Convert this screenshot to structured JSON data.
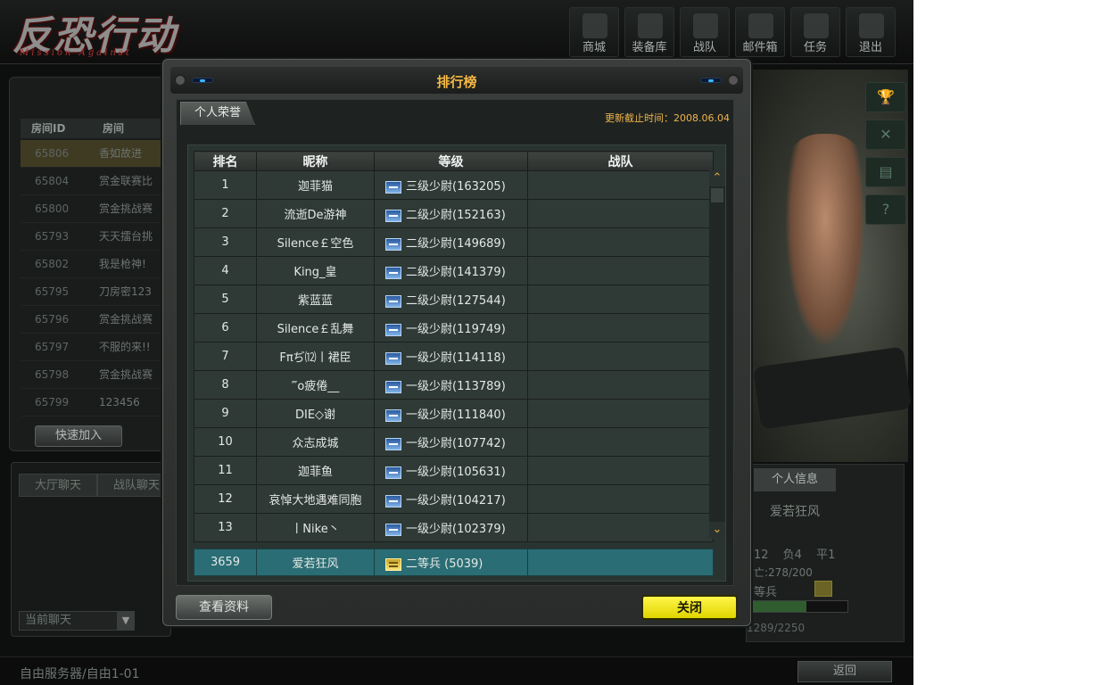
{
  "logo": {
    "text": "反恐行动",
    "sub": "Mission Against"
  },
  "nav": [
    {
      "label": "商城",
      "icon": "shop-icon"
    },
    {
      "label": "装备库",
      "icon": "armory-icon"
    },
    {
      "label": "战队",
      "icon": "clan-icon"
    },
    {
      "label": "邮件箱",
      "icon": "mailbox-icon"
    },
    {
      "label": "任务",
      "icon": "mission-icon"
    },
    {
      "label": "退出",
      "icon": "power-icon"
    }
  ],
  "room_panel": {
    "col_id": "房间ID",
    "col_name": "房间",
    "rows": [
      {
        "id": "65806",
        "name": "香如故进"
      },
      {
        "id": "65804",
        "name": "赏金联赛比"
      },
      {
        "id": "65800",
        "name": "赏金挑战赛"
      },
      {
        "id": "65793",
        "name": "天天擂台挑"
      },
      {
        "id": "65802",
        "name": "我是枪神!"
      },
      {
        "id": "65795",
        "name": "刀房密123"
      },
      {
        "id": "65796",
        "name": "赏金挑战赛"
      },
      {
        "id": "65797",
        "name": "不服的来!!"
      },
      {
        "id": "65798",
        "name": "赏金挑战赛"
      },
      {
        "id": "65799",
        "name": "123456"
      }
    ],
    "quick_join": "快速加入"
  },
  "chat": {
    "tab_lobby": "大厅聊天",
    "tab_clan": "战队聊天",
    "channel": "当前聊天"
  },
  "bottom": {
    "server": "自由服务器/自由1-01",
    "back": "返回"
  },
  "info": {
    "tab": "个人信息",
    "name": "爱若狂风",
    "stats": "12 负4 平1",
    "kd": "亡:278/200",
    "rank": "等兵",
    "exp": "1289/2250",
    "exp_fraction": 0.57
  },
  "modal": {
    "title": "排行榜",
    "tab": "个人荣誉",
    "update_time": "更新截止时间：2008.06.04",
    "columns": [
      "排名",
      "昵称",
      "等级",
      "战队"
    ],
    "rows": [
      {
        "rank": "1",
        "nick": "迦菲猫",
        "level": "三级少尉(163205)",
        "clan": ""
      },
      {
        "rank": "2",
        "nick": "流逝De游神",
        "level": "二级少尉(152163)",
        "clan": ""
      },
      {
        "rank": "3",
        "nick": "Silence￡空色",
        "level": "二级少尉(149689)",
        "clan": ""
      },
      {
        "rank": "4",
        "nick": "King_皇",
        "level": "二级少尉(141379)",
        "clan": ""
      },
      {
        "rank": "5",
        "nick": "紫蓝蓝",
        "level": "二级少尉(127544)",
        "clan": ""
      },
      {
        "rank": "6",
        "nick": "Silence￡乱舞",
        "level": "一级少尉(119749)",
        "clan": ""
      },
      {
        "rank": "7",
        "nick": "Fπぢ⑿丨裙臣",
        "level": "一级少尉(114118)",
        "clan": ""
      },
      {
        "rank": "8",
        "nick": "‴o疲倦__",
        "level": "一级少尉(113789)",
        "clan": ""
      },
      {
        "rank": "9",
        "nick": "DIE◇谢",
        "level": "一级少尉(111840)",
        "clan": ""
      },
      {
        "rank": "10",
        "nick": "众志成城",
        "level": "一级少尉(107742)",
        "clan": ""
      },
      {
        "rank": "11",
        "nick": "迦菲鱼",
        "level": "一级少尉(105631)",
        "clan": ""
      },
      {
        "rank": "12",
        "nick": "哀悼大地遇难同胞",
        "level": "一级少尉(104217)",
        "clan": ""
      },
      {
        "rank": "13",
        "nick": "丨Nike丶",
        "level": "一级少尉(102379)",
        "clan": ""
      }
    ],
    "self": {
      "rank": "3659",
      "nick": "爱若狂风",
      "level": "二等兵 (5039)",
      "clan": ""
    },
    "btn_details": "查看资料",
    "btn_close": "关闭"
  }
}
